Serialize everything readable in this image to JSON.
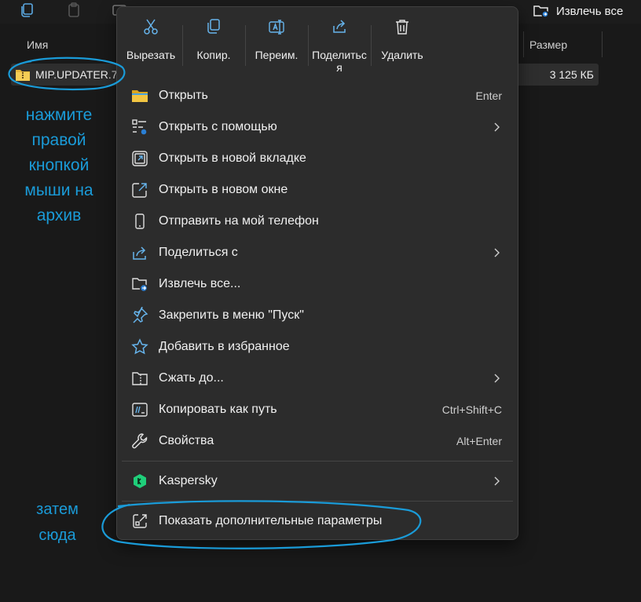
{
  "toolbar": {
    "extract_all_label": "Извлечь все"
  },
  "list": {
    "columns": {
      "name": "Имя",
      "size": "Размер"
    },
    "file": {
      "name": "MIP.UPDATER.7.",
      "size": "3 125 КБ"
    }
  },
  "annotations": {
    "top": [
      "нажмите",
      "правой",
      "кнопкой",
      "мыши на",
      "архив"
    ],
    "bottom": [
      "затем",
      "сюда"
    ],
    "color": "#1a9bd8"
  },
  "menu": {
    "quick_actions": [
      {
        "icon": "scissors-icon",
        "label": "Вырезать"
      },
      {
        "icon": "copy-icon",
        "label": "Копир."
      },
      {
        "icon": "rename-icon",
        "label": "Переим."
      },
      {
        "icon": "share-icon",
        "label": "Поделиться",
        "label_wrap": "Поделитьс\nя"
      },
      {
        "icon": "trash-icon",
        "label": "Удалить"
      }
    ],
    "items": [
      {
        "icon": "folder-icon",
        "label": "Открыть",
        "shortcut": "Enter"
      },
      {
        "icon": "open-with-icon",
        "label": "Открыть с помощью",
        "submenu": true
      },
      {
        "icon": "new-tab-icon",
        "label": "Открыть в новой вкладке"
      },
      {
        "icon": "new-window-icon",
        "label": "Открыть в новом окне"
      },
      {
        "icon": "phone-icon",
        "label": "Отправить на мой телефон"
      },
      {
        "icon": "share-icon",
        "label": "Поделиться с",
        "submenu": true
      },
      {
        "icon": "extract-icon",
        "label": "Извлечь все..."
      },
      {
        "icon": "pin-icon",
        "label": "Закрепить в меню \"Пуск\""
      },
      {
        "icon": "star-icon",
        "label": "Добавить в избранное"
      },
      {
        "icon": "compress-icon",
        "label": "Сжать до...",
        "submenu": true
      },
      {
        "icon": "copy-path-icon",
        "label": "Копировать как путь",
        "shortcut": "Ctrl+Shift+C"
      },
      {
        "icon": "wrench-icon",
        "label": "Свойства",
        "shortcut": "Alt+Enter"
      }
    ],
    "kaspersky": {
      "icon": "kaspersky-icon",
      "label": "Kaspersky",
      "submenu": true
    },
    "more": {
      "icon": "more-options-icon",
      "label": "Показать дополнительные параметры"
    }
  }
}
